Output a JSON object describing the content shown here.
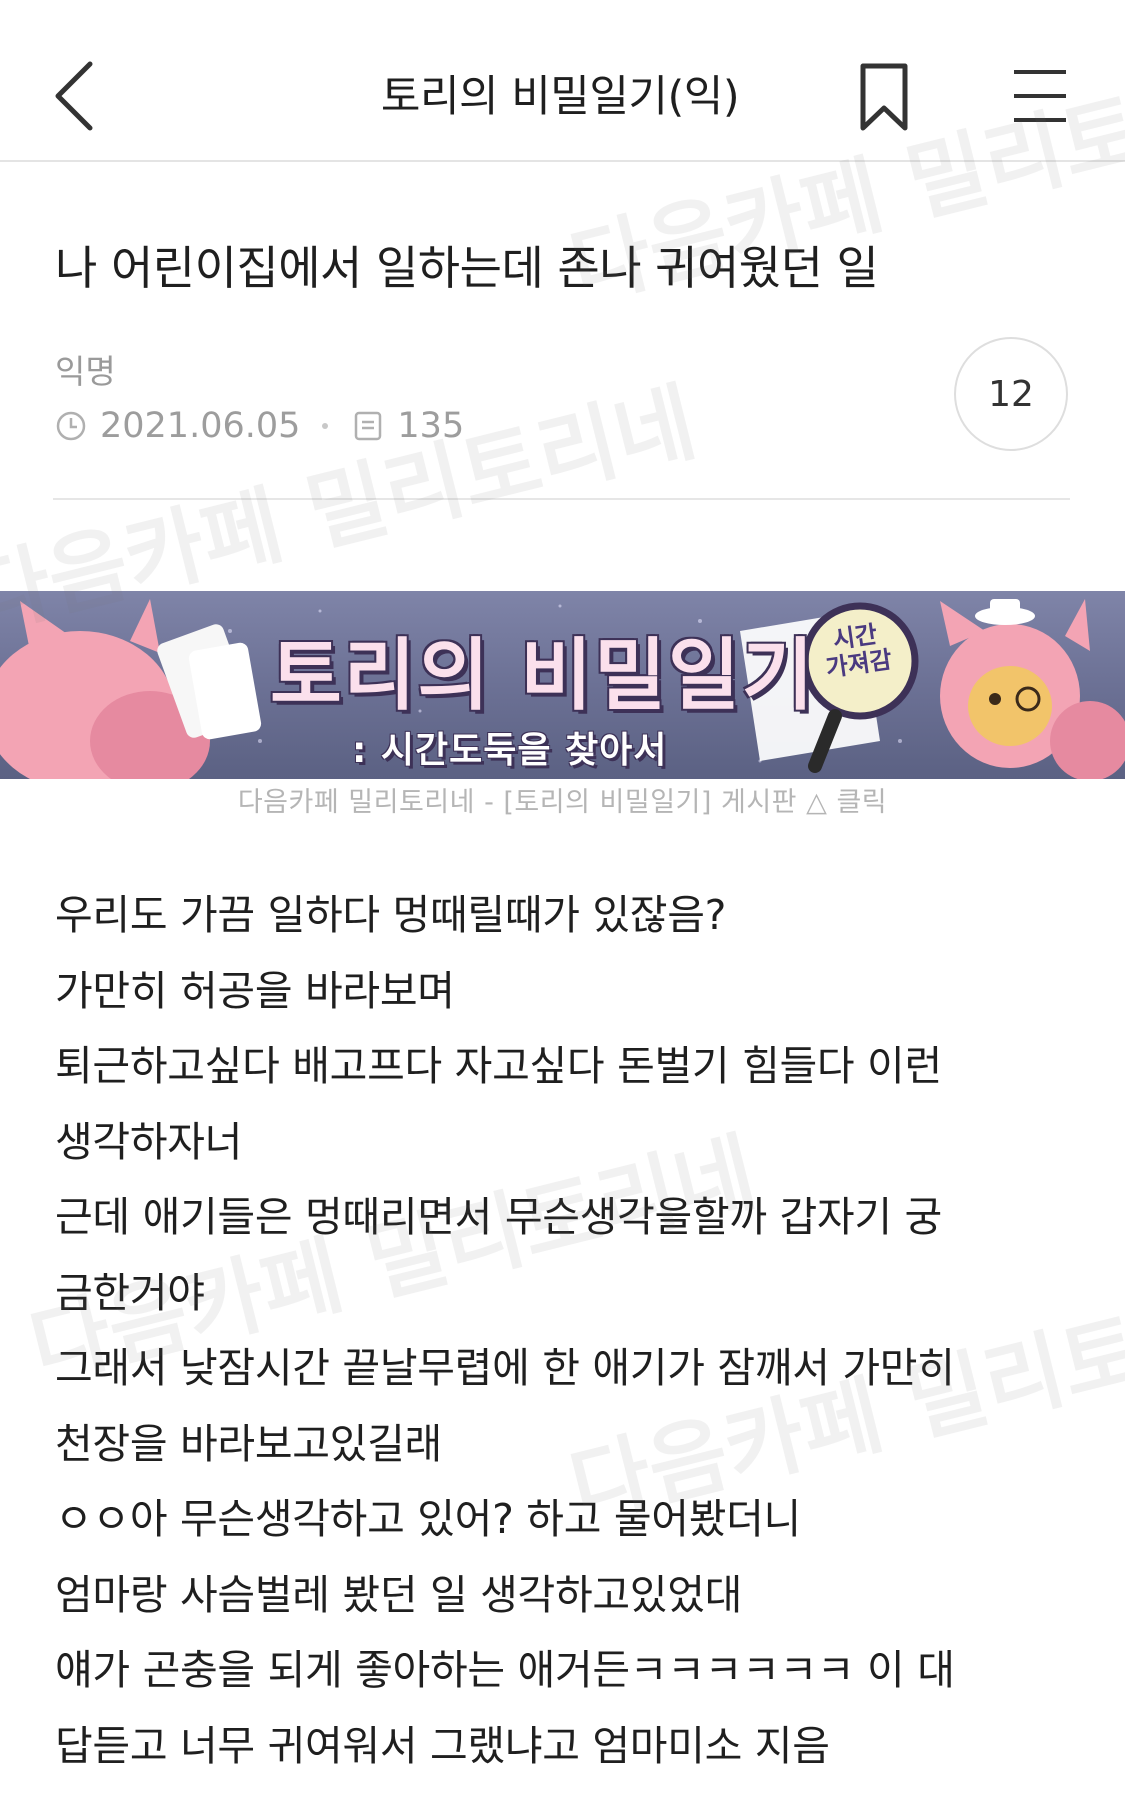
{
  "header": {
    "title": "토리의 비밀일기(익)",
    "back_icon": "chevron-left-icon",
    "bookmark_icon": "bookmark-icon",
    "menu_icon": "hamburger-menu-icon"
  },
  "post": {
    "title": "나 어린이집에서 일하는데 존나 귀여웠던 일",
    "author": "익명",
    "date": "2021.06.05",
    "views": "135",
    "comment_count": "12"
  },
  "banner": {
    "title": "토리의 비밀일기",
    "subtitle": ": 시간도둑을 찾아서",
    "stamp": "시간\n가져감",
    "caption": "다음카페 밀리토리네 - [토리의 비밀일기] 게시판 △ 클릭"
  },
  "body_lines": [
    "우리도 가끔 일하다 멍때릴때가 있잖음?",
    "가만히 허공을 바라보며",
    "퇴근하고싶다 배고프다 자고싶다 돈벌기 힘들다 이런",
    "생각하자너",
    "근데 애기들은 멍때리면서 무슨생각을할까 갑자기 궁",
    "금한거야",
    "그래서 낮잠시간 끝날무렵에 한 애기가 잠깨서 가만히",
    "천장을 바라보고있길래",
    "ㅇㅇ아 무슨생각하고 있어? 하고 물어봤더니",
    "엄마랑 사슴벌레 봤던 일 생각하고있었대",
    "얘가 곤충을 되게 좋아하는 애거든ㅋㅋㅋㅋㅋㅋ 이 대",
    "답듣고 너무 귀여워서 그랬냐고 엄마미소 지음"
  ],
  "watermarks": [
    "다음카페 밀리토리네",
    "다음카페 밀리토리네",
    "다음카페 밀리토리네",
    "다음카페 밀리토리네"
  ],
  "colors": {
    "banner_bg": "#6c7195",
    "banner_title": "#fbe0ec",
    "meta_gray": "#9d9d9d"
  }
}
